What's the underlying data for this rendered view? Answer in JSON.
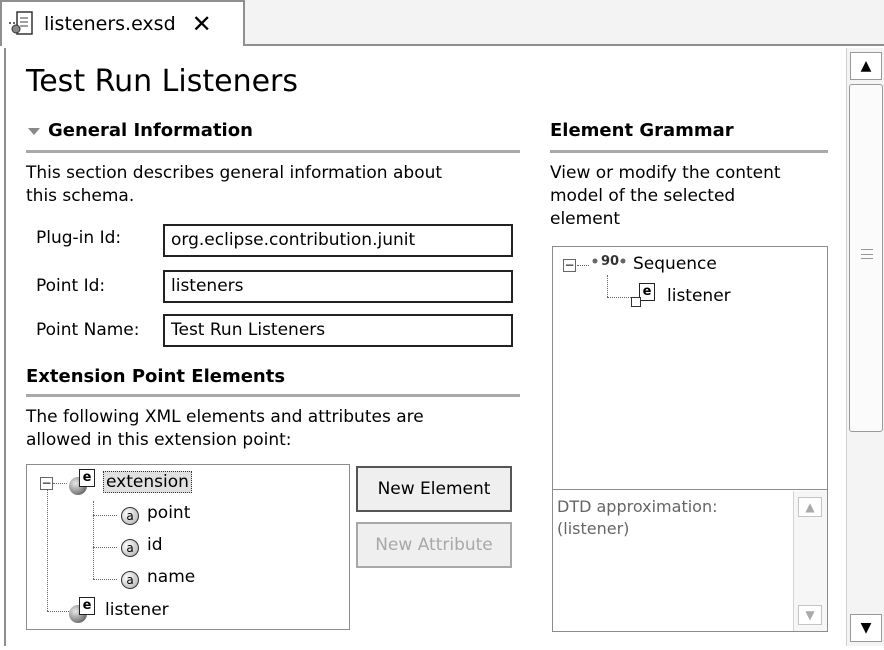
{
  "tab": {
    "label": "listeners.exsd",
    "close_glyph": "✕"
  },
  "page": {
    "title": "Test Run Listeners"
  },
  "general": {
    "heading": "General Information",
    "description_line1": "This section describes general information about",
    "description_line2": "this schema.",
    "fields": [
      {
        "label": "Plug-in Id:",
        "value": "org.eclipse.contribution.junit"
      },
      {
        "label": "Point Id:",
        "value": "listeners"
      },
      {
        "label": "Point Name:",
        "value": "Test Run Listeners"
      }
    ]
  },
  "elements": {
    "heading": "Extension Point Elements",
    "description_line1": "The following XML elements and attributes are",
    "description_line2": "allowed in this extension point:",
    "tree": {
      "root": "extension",
      "attributes": [
        "point",
        "id",
        "name"
      ],
      "second": "listener",
      "icon_letter": "e",
      "attr_letter": "a"
    },
    "buttons": {
      "new_element": "New Element",
      "new_attribute": "New Attribute"
    }
  },
  "grammar": {
    "heading": "Element Grammar",
    "description_line1": "View or modify the content",
    "description_line2": "model of the selected",
    "description_line3": "element",
    "tree": {
      "root": "Sequence",
      "child": "listener",
      "icon_letter": "e"
    },
    "dtd_line1": "DTD approximation:",
    "dtd_line2": "(listener)"
  },
  "scroll": {
    "up": "▲",
    "down": "▼"
  }
}
